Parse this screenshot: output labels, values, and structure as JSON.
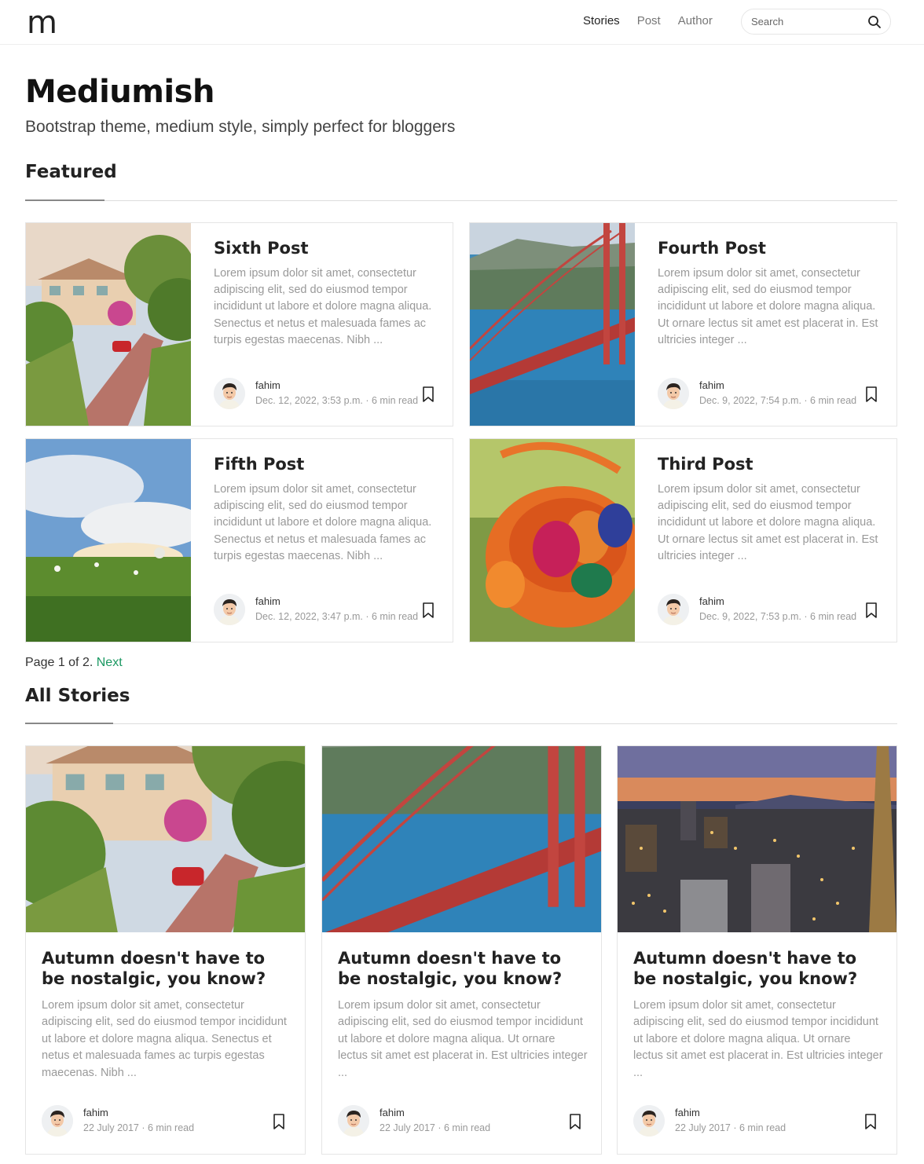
{
  "nav": {
    "brand": "m",
    "links": [
      "Stories",
      "Post",
      "Author"
    ],
    "search_placeholder": "Search"
  },
  "hero": {
    "title": "Mediumish",
    "tagline": "Bootstrap theme, medium style, simply perfect for bloggers"
  },
  "featured": {
    "heading": "Featured",
    "posts": [
      {
        "title": "Sixth Post",
        "excerpt": "Lorem ipsum dolor sit amet, consectetur adipiscing elit, sed do eiusmod tempor incididunt ut labore et dolore magna aliqua. Senectus et netus et malesuada fames ac turpis egestas maecenas. Nibh ...",
        "author": "fahim",
        "meta": "Dec. 12, 2022, 3:53 p.m. · 6 min read",
        "image": "street-hill"
      },
      {
        "title": "Fourth Post",
        "excerpt": "Lorem ipsum dolor sit amet, consectetur adipiscing elit, sed do eiusmod tempor incididunt ut labore et dolore magna aliqua. Ut ornare lectus sit amet est placerat in. Est ultricies integer ...",
        "author": "fahim",
        "meta": "Dec. 9, 2022, 7:54 p.m. · 6 min read",
        "image": "bridge"
      },
      {
        "title": "Fifth Post",
        "excerpt": "Lorem ipsum dolor sit amet, consectetur adipiscing elit, sed do eiusmod tempor incididunt ut labore et dolore magna aliqua. Senectus et netus et malesuada fames ac turpis egestas maecenas. Nibh ...",
        "author": "fahim",
        "meta": "Dec. 12, 2022, 3:47 p.m. · 6 min read",
        "image": "meadow-sky"
      },
      {
        "title": "Third Post",
        "excerpt": "Lorem ipsum dolor sit amet, consectetur adipiscing elit, sed do eiusmod tempor incididunt ut labore et dolore magna aliqua. Ut ornare lectus sit amet est placerat in. Est ultricies integer ...",
        "author": "fahim",
        "meta": "Dec. 9, 2022, 7:53 p.m. · 6 min read",
        "image": "easter-basket"
      }
    ]
  },
  "pagination": {
    "text": "Page 1 of 2. ",
    "next": "Next"
  },
  "stories": {
    "heading": "All Stories",
    "posts": [
      {
        "title": "Autumn doesn't have to be nostalgic, you know?",
        "excerpt": "Lorem ipsum dolor sit amet, consectetur adipiscing elit, sed do eiusmod tempor incididunt ut labore et dolore magna aliqua. Senectus et netus et malesuada fames ac turpis egestas maecenas. Nibh ...",
        "author": "fahim",
        "meta": "22 July 2017 · 6 min read",
        "image": "street-hill"
      },
      {
        "title": "Autumn doesn't have to be nostalgic, you know?",
        "excerpt": "Lorem ipsum dolor sit amet, consectetur adipiscing elit, sed do eiusmod tempor incididunt ut labore et dolore magna aliqua. Ut ornare lectus sit amet est placerat in. Est ultricies integer ...",
        "author": "fahim",
        "meta": "22 July 2017 · 6 min read",
        "image": "bridge"
      },
      {
        "title": "Autumn doesn't have to be nostalgic, you know?",
        "excerpt": "Lorem ipsum dolor sit amet, consectetur adipiscing elit, sed do eiusmod tempor incididunt ut labore et dolore magna aliqua. Ut ornare lectus sit amet est placerat in. Est ultricies integer ...",
        "author": "fahim",
        "meta": "22 July 2017 · 6 min read",
        "image": "city-dusk"
      }
    ]
  },
  "colors": {
    "accent": "#1c9963",
    "title": "#222222",
    "muted": "#999999"
  }
}
